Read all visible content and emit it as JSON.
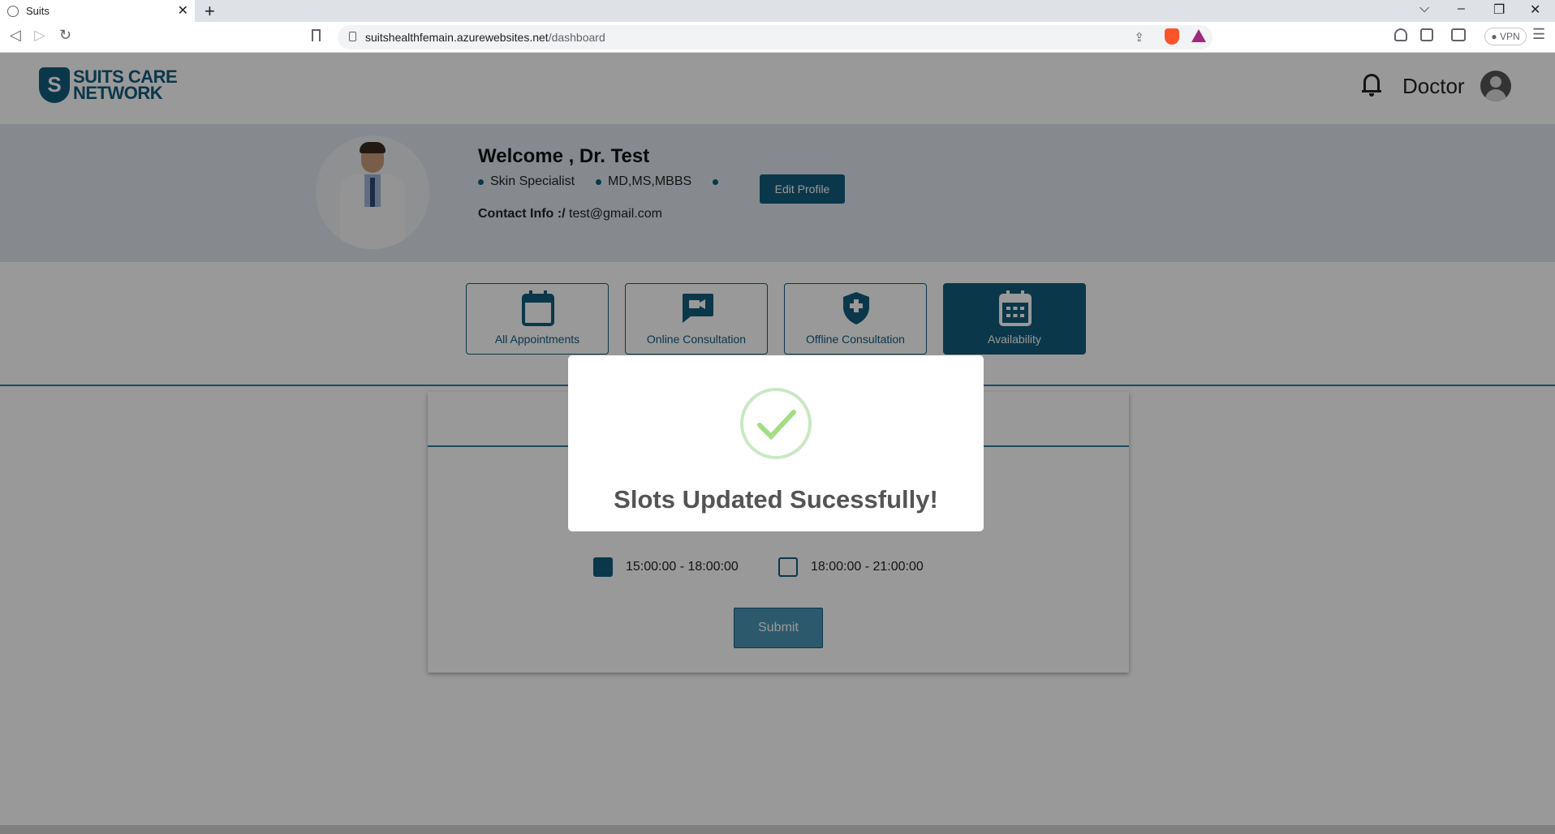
{
  "browser": {
    "tab_title": "Suits",
    "tab_close": "✕",
    "new_tab": "+",
    "url_host": "suitshealthfemain.azurewebsites.net",
    "url_path": "/dashboard",
    "vpn_label": "● VPN",
    "window_controls": [
      "⌵",
      "–",
      "❐",
      "✕"
    ]
  },
  "navbar": {
    "logo_mark": "S",
    "logo_line1": "SUITS CARE",
    "logo_line2": "NETWORK",
    "user_label": "Doctor"
  },
  "profile": {
    "welcome": "Welcome , Dr. Test",
    "specialty": "Skin Specialist",
    "degrees": "MD,MS,MBBS",
    "contact_label": "Contact Info :/",
    "contact_value": "test@gmail.com",
    "edit_button": "Edit Profile"
  },
  "tabs": [
    {
      "label": "All Appointments",
      "icon": "calendar-icon",
      "active": false
    },
    {
      "label": "Online Consultation",
      "icon": "video-chat-icon",
      "active": false
    },
    {
      "label": "Offline Consultation",
      "icon": "medical-shield-icon",
      "active": false
    },
    {
      "label": "Availability",
      "icon": "calendar-grid-icon",
      "active": true
    }
  ],
  "availability": {
    "slots": [
      {
        "label": "15:00:00 - 18:00:00",
        "checked": true
      },
      {
        "label": "18:00:00 - 21:00:00",
        "checked": false
      }
    ],
    "submit_label": "Submit"
  },
  "modal": {
    "title": "Slots Updated Sucessfully!",
    "icon": "success-check-icon"
  },
  "colors": {
    "brand": "#135c7c",
    "success": "#a5dc86"
  }
}
